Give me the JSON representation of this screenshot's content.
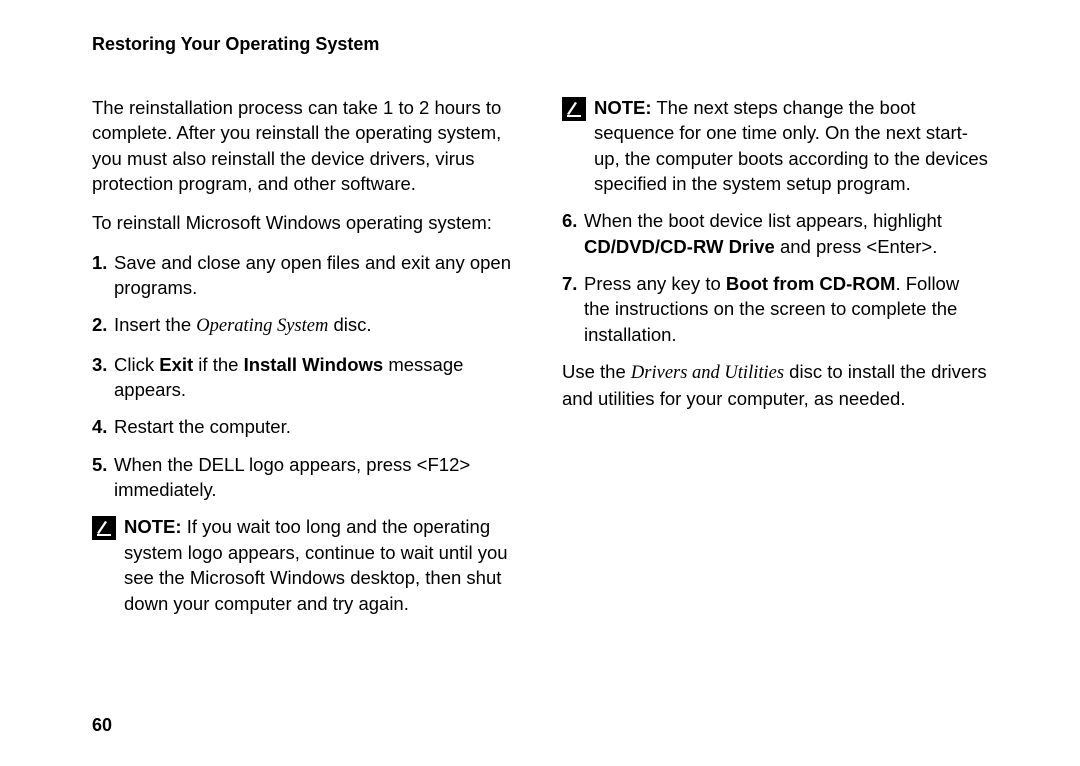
{
  "header": "Restoring Your Operating System",
  "page_number": "60",
  "left": {
    "intro": "The reinstallation process can take 1 to 2 hours to complete. After you reinstall the operating system, you must also reinstall the device drivers, virus protection program, and other software.",
    "lead": "To reinstall Microsoft Windows operating system:",
    "step1_num": "1.",
    "step1": "Save and close any open files and exit any open programs.",
    "step2_num": "2.",
    "step2_a": "Insert the ",
    "step2_em": "Operating System",
    "step2_b": " disc.",
    "step3_num": "3.",
    "step3_a": "Click ",
    "step3_b1": "Exit",
    "step3_b": " if the ",
    "step3_b2": "Install Windows",
    "step3_c": " message appears.",
    "step4_num": "4.",
    "step4": "Restart the computer.",
    "step5_num": "5.",
    "step5": "When the DELL logo appears, press <F12> immediately.",
    "note1_label": "NOTE:",
    "note1_body": " If you wait too long and the operating system logo appears, continue to wait until you see the Microsoft Windows desktop, then shut down your computer and try again."
  },
  "right": {
    "note2_label": "NOTE:",
    "note2_body": " The next steps change the boot sequence for one time only. On the next start-up, the computer boots according to the devices specified in the system setup program.",
    "step6_num": "6.",
    "step6_a": "When the boot device list appears, highlight ",
    "step6_b": "CD/DVD/CD-RW Drive",
    "step6_c": " and press <Enter>.",
    "step7_num": "7.",
    "step7_a": "Press any key to ",
    "step7_b": "Boot from CD-ROM",
    "step7_c": ". Follow the instructions on the screen to complete the installation.",
    "closing_a": "Use the ",
    "closing_em": "Drivers and Utilities",
    "closing_b": " disc to install the drivers and utilities for your computer, as needed."
  }
}
